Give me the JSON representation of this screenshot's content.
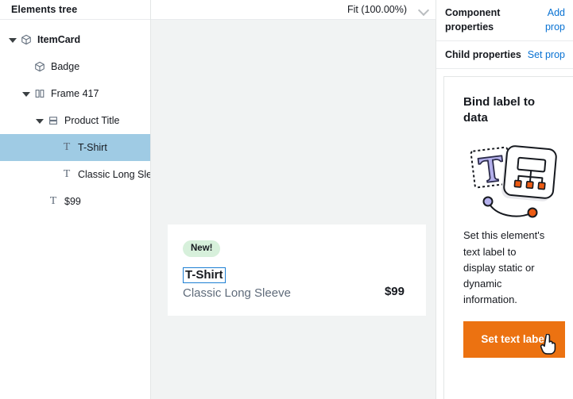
{
  "sidebar": {
    "header": "Elements tree",
    "tree": [
      {
        "label": "ItemCard",
        "icon": "cube-icon",
        "indent": 0,
        "caret": "open",
        "bold": true,
        "selected": false
      },
      {
        "label": "Badge",
        "icon": "cube-icon",
        "indent": 1,
        "caret": "none",
        "bold": false,
        "selected": false
      },
      {
        "label": "Frame 417",
        "icon": "columns-icon",
        "indent": 1,
        "caret": "open",
        "bold": false,
        "selected": false
      },
      {
        "label": "Product Title",
        "icon": "rows-icon",
        "indent": 2,
        "caret": "open",
        "bold": false,
        "selected": false
      },
      {
        "label": "T-Shirt",
        "icon": "text-icon",
        "indent": 3,
        "caret": "none",
        "bold": false,
        "selected": true
      },
      {
        "label": "Classic Long Slee",
        "icon": "text-icon",
        "indent": 3,
        "caret": "none",
        "bold": false,
        "selected": false
      },
      {
        "label": "$99",
        "icon": "text-icon",
        "indent": 2,
        "caret": "none",
        "bold": false,
        "selected": false
      }
    ]
  },
  "canvas": {
    "zoom_label": "Fit (100.00%)",
    "zoom_chevron_icon": "chevron-down-icon",
    "card": {
      "badge": "New!",
      "title": "T-Shirt",
      "subtitle": "Classic Long Sleeve",
      "price": "$99"
    }
  },
  "right_panel": {
    "component_properties": {
      "title": "Component properties",
      "link": "Add prop"
    },
    "child_properties": {
      "title": "Child properties",
      "link": "Set prop"
    },
    "hint": {
      "heading": "Bind label to data",
      "illustration_icon": "bind-label-illustration",
      "body": "Set this element's text label to display static or dynamic information.",
      "button_label": "Set text label",
      "cursor_icon": "pointer-cursor-icon"
    }
  },
  "colors": {
    "accent_orange": "#ec7211",
    "link_blue": "#0972d3",
    "selection_blue": "#9fcbe4",
    "selection_outline_blue": "#1d7fd4",
    "badge_green": "#d7f0db",
    "canvas_gray": "#f1f3f3"
  }
}
